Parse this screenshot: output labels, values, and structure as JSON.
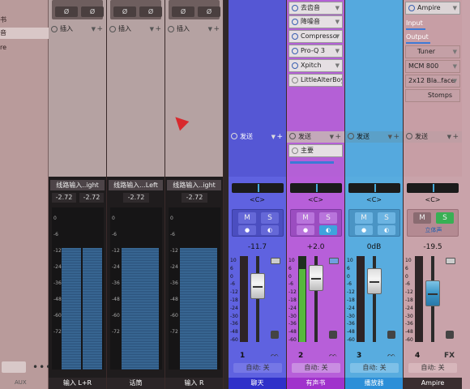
{
  "left_panel": {
    "items": [
      {
        "label": "书"
      },
      {
        "label": "音"
      },
      {
        "label": "re"
      }
    ],
    "aux_label": "AUX",
    "more_label": "•••"
  },
  "strips": [
    {
      "name_bar": "线路输入..ight",
      "db_left": "-2.72",
      "db_right": "-2.72",
      "insert_label": "插入",
      "label": "输入 L+R",
      "meter_left": 0.96,
      "meter_right": 0.96
    },
    {
      "name_bar": "线路输入...Left",
      "db": "-2.72",
      "insert_label": "插入",
      "label": "话筒",
      "meter": 0.96
    },
    {
      "name_bar": "线路输入..ight",
      "db": "-2.72",
      "insert_label": "插入",
      "label": "输入 R",
      "meter": 0.96
    }
  ],
  "meter_scale": [
    "0",
    "-6",
    "-12",
    "-24",
    "-36",
    "-48",
    "-60",
    "-72"
  ],
  "channels": [
    {
      "label": "聊天",
      "send_label": "发送",
      "pan": "<C>",
      "mute": "M",
      "solo": "S",
      "fader_value": "-11.7",
      "number": "1",
      "auto": "自动: 关",
      "color": "#5a5bd6",
      "level": 0.72
    },
    {
      "label": "有声书",
      "send_label": "发送",
      "send_target": "主要",
      "pan": "<C>",
      "mute": "M",
      "solo": "S",
      "fader_value": "+2.0",
      "number": "2",
      "auto": "自动: 关",
      "color": "#b558d6",
      "level": 0.85,
      "plugins": [
        "去齿音",
        "降噪音",
        "Compressor",
        "Pro-Q 3",
        "Xpitch",
        "LittleAlterBoy"
      ]
    },
    {
      "label": "播放器",
      "send_label": "发送",
      "pan": "<C>",
      "mute": "M",
      "solo": "S",
      "fader_value": "0dB",
      "number": "3",
      "auto": "自动: 关",
      "color": "#55a9de",
      "level": 0.8
    },
    {
      "label": "Ampire",
      "send_label": "发送",
      "pan": "<C>",
      "mute": "M",
      "solo": "S",
      "stereo_label": "立体声",
      "fader_value": "-19.5",
      "number": "4",
      "fx_label": "FX",
      "auto": "自动: 关",
      "color": "#c79ea5",
      "level": 0.6,
      "ampire": {
        "plugin": "Ampire",
        "input_label": "Input",
        "output_label": "Output",
        "tuner_label": "Tuner",
        "amp_model": "MCM 800",
        "cab_model": "2x12 Bla..face",
        "stomps_label": "Stomps"
      }
    }
  ],
  "fader_scale": [
    "10",
    "6",
    "0",
    "-6",
    "-12",
    "-18",
    "-24",
    "-30",
    "-36",
    "-48",
    "-60"
  ],
  "bypass_glyph": "Ø"
}
